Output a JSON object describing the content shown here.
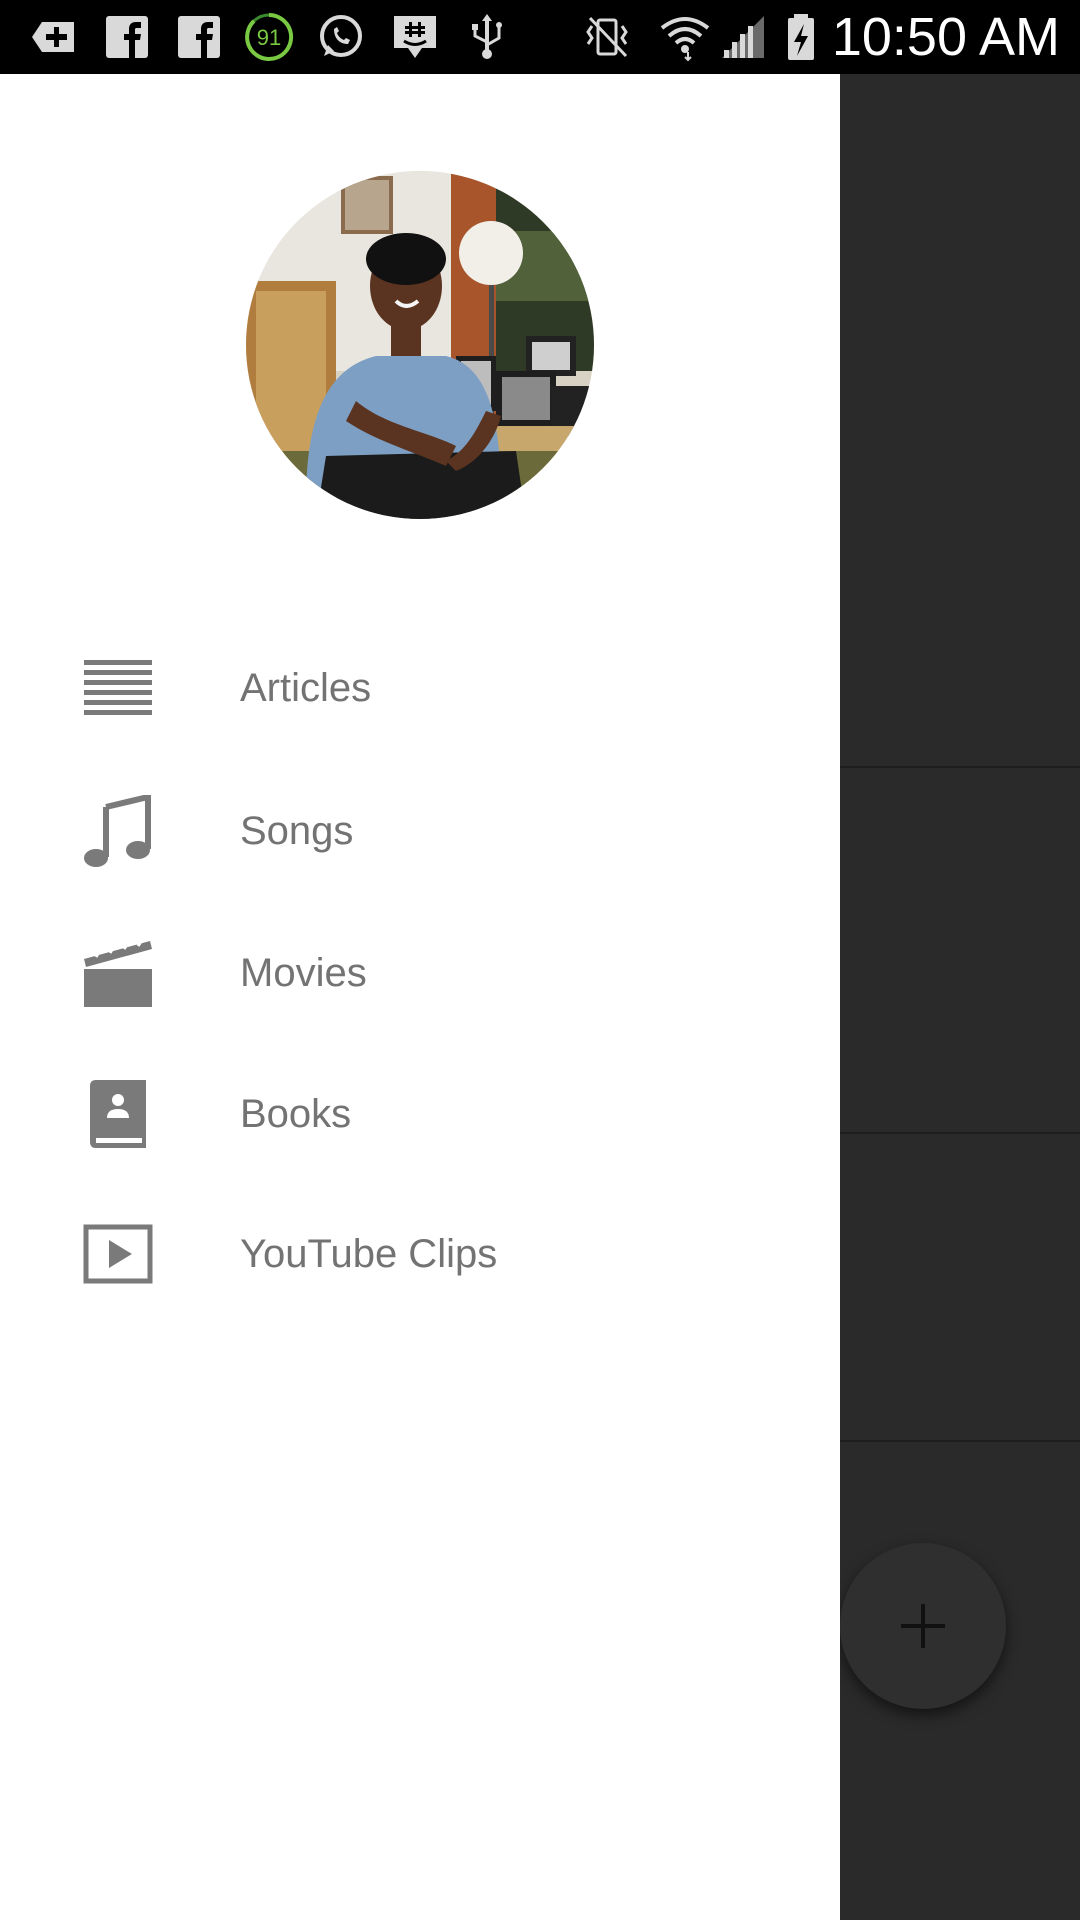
{
  "status_bar": {
    "time": "10:50 AM",
    "badge_number": "91",
    "icons": [
      "add-box-icon",
      "facebook-icon",
      "facebook-icon",
      "battery-saver-badge-icon",
      "whatsapp-icon",
      "chat-app-icon",
      "usb-icon",
      "vibrate-mute-icon",
      "wifi-icon",
      "cell-signal-icon",
      "battery-charging-icon"
    ]
  },
  "drawer": {
    "profile": {
      "avatar_icon": "profile-photo"
    },
    "menu": [
      {
        "label": "Articles",
        "icon": "articles-icon"
      },
      {
        "label": "Songs",
        "icon": "music-note-icon"
      },
      {
        "label": "Movies",
        "icon": "clapperboard-icon"
      },
      {
        "label": "Books",
        "icon": "book-icon"
      },
      {
        "label": "YouTube Clips",
        "icon": "play-box-icon"
      }
    ]
  },
  "fab": {
    "icon": "plus-icon"
  },
  "colors": {
    "status_bar": "#000000",
    "drawer_bg": "#ffffff",
    "menu_text": "#737373",
    "scrim_content": "#2a2a2a",
    "icon_gray": "#7a7a7a"
  }
}
